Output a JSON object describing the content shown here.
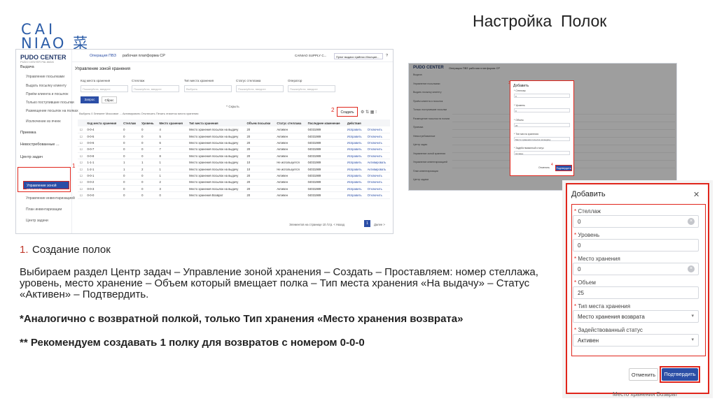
{
  "logo": {
    "line1": "CAI",
    "line2": "NIAO 菜鸟"
  },
  "slide_title": "Настройка  Полок",
  "colors": {
    "accent": "#2b4ea6",
    "highlight": "#e0251b",
    "brand": "#2c5da8"
  },
  "shot1": {
    "logo": "PUDO CENTER",
    "logo_sub": "PUDO CENTER PAI-MIAN",
    "tabs": [
      "Операция ПВЗ",
      "рабочая платформа СР"
    ],
    "user": "CAINIAO SUPPLY C...",
    "user_point": "Пункт выдачи Цайняо Ильнцан...",
    "nav": [
      {
        "label": "Выдача",
        "section": true
      },
      {
        "label": "Управление посылками",
        "section": false
      },
      {
        "label": "Выдать посылку клиенту",
        "section": false
      },
      {
        "label": "Приём клиента и посылок",
        "section": false
      },
      {
        "label": "Только поступившие посылки",
        "section": false
      },
      {
        "label": "Размещение посылок на полках",
        "section": false
      },
      {
        "label": "Исключение из ячеек",
        "section": false
      },
      {
        "label": "Приемка",
        "section": true
      },
      {
        "label": "Невостребованные ...",
        "section": true
      },
      {
        "label": "Центр задач",
        "section": true
      },
      {
        "label": "Управление инвентаризацией",
        "section": false
      },
      {
        "label": "План инвентаризации",
        "section": false
      },
      {
        "label": "Центр задачи",
        "section": false
      }
    ],
    "active_item": "Управление зоной хранения",
    "label_1": "1",
    "label_2": "2",
    "page_title": "Управление зоной хранения",
    "filters": [
      {
        "label": "Код места хранения",
        "placeholder": "Пожалуйста, введите"
      },
      {
        "label": "Стеллаж",
        "placeholder": "Пожалуйста, введите"
      },
      {
        "label": "Тип места хранения",
        "placeholder": "Выбрать"
      },
      {
        "label": "Статус стеллажа",
        "placeholder": "Пожалуйста, введите"
      },
      {
        "label": "Оператор",
        "placeholder": "Пожалуйста, введите"
      }
    ],
    "query": "Запрос",
    "reset": "Сброс",
    "hide": "^ Скрыть",
    "create": "Создать",
    "toolbar": "Выбрать 0 Элемент  Массовое ...  Активировать  Отключить  Печать этикеток места хранения",
    "columns": [
      "",
      "Код места хранения",
      "Стеллаж",
      "Уровень",
      "Место хранения",
      "Тип места хранения",
      "Объем посылки",
      "Статус стеллажа",
      "Последнее изменение",
      "Действия",
      ""
    ],
    "rows": [
      [
        "0-0-4",
        "0",
        "0",
        "4",
        "Место хранения посылок на выдачу",
        "20",
        "Активен",
        "04031989",
        "Исправить",
        "Отключить"
      ],
      [
        "0-0-5",
        "0",
        "0",
        "5",
        "Место хранения посылок на выдачу",
        "20",
        "Активен",
        "04031989",
        "Исправить",
        "Отключить"
      ],
      [
        "0-0-6",
        "0",
        "0",
        "6",
        "Место хранения посылок на выдачу",
        "20",
        "Активен",
        "04031989",
        "Исправить",
        "Отключить"
      ],
      [
        "0-0-7",
        "0",
        "0",
        "7",
        "Место хранения посылок на выдачу",
        "20",
        "Активен",
        "04031989",
        "Исправить",
        "Отключить"
      ],
      [
        "0-0-8",
        "0",
        "0",
        "8",
        "Место хранения посылок на выдачу",
        "20",
        "Активен",
        "04031989",
        "Исправить",
        "Отключить"
      ],
      [
        "1-1-1",
        "1",
        "1",
        "1",
        "Место хранения посылок на выдачу",
        "10",
        "Не используется",
        "04031989",
        "Исправить",
        "Активировать"
      ],
      [
        "1-2-1",
        "1",
        "2",
        "1",
        "Место хранения посылок на выдачу",
        "10",
        "Не используется",
        "04031989",
        "Исправить",
        "Активировать"
      ],
      [
        "0-0-1",
        "0",
        "0",
        "1",
        "Место хранения посылок на выдачу",
        "20",
        "Активен",
        "04031989",
        "Исправить",
        "Отключить"
      ],
      [
        "0-0-2",
        "0",
        "0",
        "2",
        "Место хранения посылок на выдачу",
        "20",
        "Активен",
        "04031989",
        "Исправить",
        "Отключить"
      ],
      [
        "0-0-3",
        "0",
        "0",
        "3",
        "Место хранения посылок на выдачу",
        "20",
        "Активен",
        "04031989",
        "Исправить",
        "Отключить"
      ],
      [
        "0-0-0",
        "0",
        "0",
        "0",
        "Место хранения Возврат",
        "20",
        "Активен",
        "04031989",
        "Исправить",
        "Отключить"
      ]
    ],
    "pagination": "Элементов на странице  10 /стр.   < Назад",
    "page": "1",
    "next": "Далее >"
  },
  "shot2": {
    "logo": "PUDO CENTER",
    "top": "Операция ПВЗ   рабочая платформа СР",
    "nav": [
      "Выдача",
      "Управление посылками",
      "Выдать посылку клиенту",
      "Приём клиента и посылок",
      "Только поступившие посылки",
      "Размещение посылок на полках",
      "Приемка",
      "Невостребованные",
      "Центр задач",
      "Управление зоной хранения",
      "Управление инвентаризацией",
      "План инвентаризации",
      "Центр задачи"
    ],
    "modal_title": "Добавить",
    "fields": [
      {
        "label": "* Стеллаж",
        "value": "0"
      },
      {
        "label": "* Уровень",
        "value": "0"
      },
      {
        "label": "* Объем",
        "value": "20"
      },
      {
        "label": "* Тип места хранения",
        "value": "Место хранения посылок на выдачу"
      },
      {
        "label": "* Задействованный статус",
        "value": "Активен"
      }
    ],
    "cancel": "Отменить",
    "ok": "Подтвердить",
    "label_3": "3",
    "label_4": "4"
  },
  "modal": {
    "title": "Добавить",
    "close": "✕",
    "fields": [
      {
        "label": "Стеллаж",
        "value": "0",
        "kind": "clear"
      },
      {
        "label": "Уровень",
        "value": "0",
        "kind": "text"
      },
      {
        "label": "Место хранения",
        "value": "0",
        "kind": "clear"
      },
      {
        "label": "Объем",
        "value": "25",
        "kind": "text"
      },
      {
        "label": "Тип места хранения",
        "value": "Место хранения возврата",
        "kind": "select"
      },
      {
        "label": "Задействованный статус",
        "value": "Активен",
        "kind": "select"
      }
    ],
    "required_mark": "*",
    "cancel": "Отменить",
    "confirm": "Подтвердить",
    "footer": "Место хранения Возврат"
  },
  "text": {
    "step_num": "1.",
    "step_title": "Создание полок",
    "description": "Выбираем раздел Центр задач – Управление зоной хранения – Создать – Проставляем: номер стеллажа, уровень, место хранение – Объем который вмещает полка – Тип места хранения «На выдачу» – Статус «Активен» – Подтвердить.",
    "note1": "*Аналогично с возвратной полкой, только Тип хранения «Место хранения возврата»",
    "note2": "** Рекомендуем создавать 1 полку для возвратов с номером 0-0-0"
  },
  "icons": [
    "gear-icon",
    "clear-icon",
    "chevron-down-icon",
    "close-icon",
    "help-icon",
    "settings-icon"
  ]
}
